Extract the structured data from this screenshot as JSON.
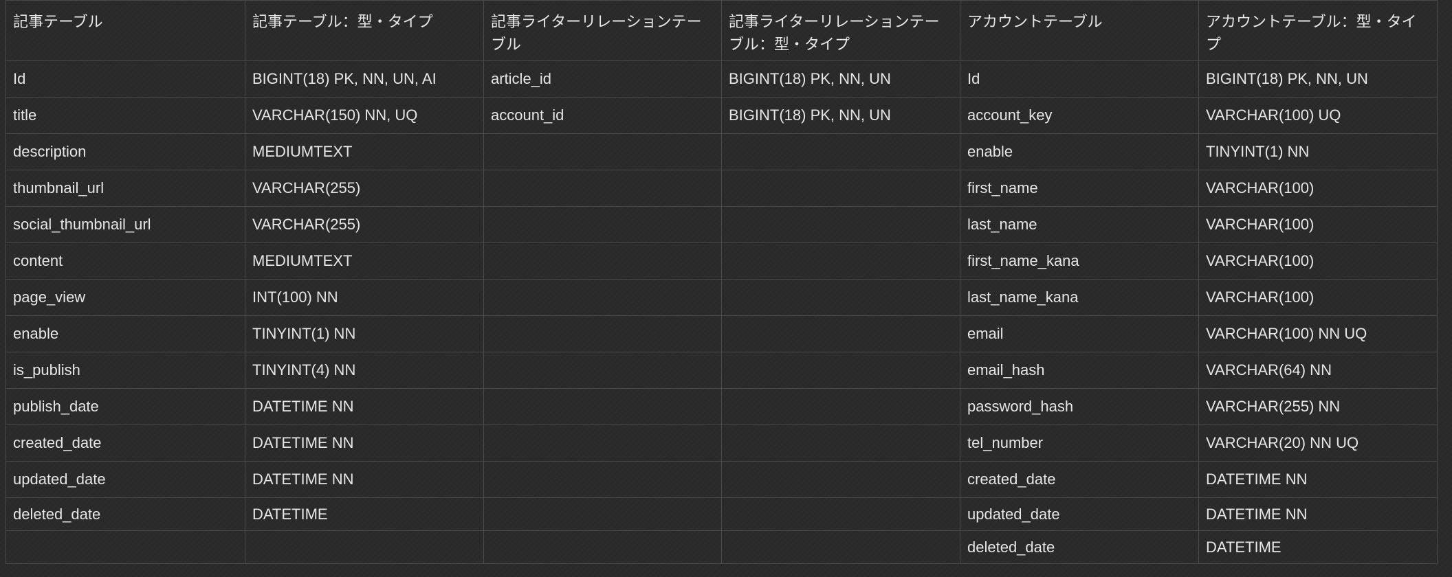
{
  "headers": [
    "記事テーブル",
    "記事テーブル：型・タイプ",
    "記事ライターリレーションテーブル",
    "記事ライターリレーションテーブル：型・タイプ",
    "アカウントテーブル",
    "アカウントテーブル：型・タイプ"
  ],
  "rows": [
    [
      "Id",
      "BIGINT(18) PK,  NN, UN, AI",
      "article_id",
      "BIGINT(18) PK, NN, UN",
      "Id",
      "BIGINT(18) PK, NN, UN"
    ],
    [
      "title",
      "VARCHAR(150) NN, UQ",
      "account_id",
      "BIGINT(18) PK, NN, UN",
      "account_key",
      "VARCHAR(100) UQ"
    ],
    [
      "description",
      "MEDIUMTEXT",
      "",
      "",
      "enable",
      "TINYINT(1) NN"
    ],
    [
      "thumbnail_url",
      "VARCHAR(255)",
      "",
      "",
      "first_name",
      "VARCHAR(100)"
    ],
    [
      "social_thumbnail_url",
      "VARCHAR(255)",
      "",
      "",
      "last_name",
      "VARCHAR(100)"
    ],
    [
      "content",
      "MEDIUMTEXT",
      "",
      "",
      "first_name_kana",
      "VARCHAR(100)"
    ],
    [
      "page_view",
      "INT(100) NN",
      "",
      "",
      "last_name_kana",
      "VARCHAR(100)"
    ],
    [
      "enable",
      "TINYINT(1) NN",
      "",
      "",
      "email",
      "VARCHAR(100) NN UQ"
    ],
    [
      "is_publish",
      "TINYINT(4) NN",
      "",
      "",
      "email_hash",
      "VARCHAR(64) NN"
    ],
    [
      "publish_date",
      "DATETIME NN",
      "",
      "",
      "password_hash",
      "VARCHAR(255) NN"
    ],
    [
      "created_date",
      "DATETIME NN",
      "",
      "",
      "tel_number",
      "VARCHAR(20) NN UQ"
    ],
    [
      "updated_date",
      "DATETIME NN",
      "",
      "",
      "created_date",
      "DATETIME NN"
    ],
    [
      "deleted_date",
      "DATETIME",
      "",
      "",
      "updated_date",
      "DATETIME NN"
    ],
    [
      "",
      "",
      "",
      "",
      "deleted_date",
      "DATETIME"
    ]
  ]
}
